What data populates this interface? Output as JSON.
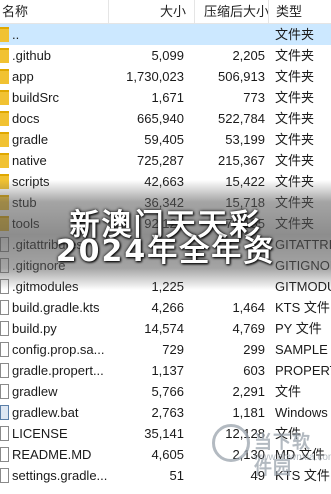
{
  "header": {
    "name": "名称",
    "size": "大小",
    "compressed": "压缩后大小",
    "type": "类型"
  },
  "rows": [
    {
      "name": "..",
      "size": "",
      "csize": "",
      "type": "文件夹",
      "icon": "folder",
      "selected": true
    },
    {
      "name": ".github",
      "size": "5,099",
      "csize": "2,205",
      "type": "文件夹",
      "icon": "folder"
    },
    {
      "name": "app",
      "size": "1,730,023",
      "csize": "506,913",
      "type": "文件夹",
      "icon": "folder"
    },
    {
      "name": "buildSrc",
      "size": "1,671",
      "csize": "773",
      "type": "文件夹",
      "icon": "folder"
    },
    {
      "name": "docs",
      "size": "665,940",
      "csize": "522,784",
      "type": "文件夹",
      "icon": "folder"
    },
    {
      "name": "gradle",
      "size": "59,405",
      "csize": "53,199",
      "type": "文件夹",
      "icon": "folder"
    },
    {
      "name": "native",
      "size": "725,287",
      "csize": "215,367",
      "type": "文件夹",
      "icon": "folder"
    },
    {
      "name": "scripts",
      "size": "42,663",
      "csize": "15,422",
      "type": "文件夹",
      "icon": "folder"
    },
    {
      "name": "stub",
      "size": "36,342",
      "csize": "15,718",
      "type": "文件夹",
      "icon": "folder"
    },
    {
      "name": "tools",
      "size": "92,129",
      "csize": "70,185",
      "type": "文件夹",
      "icon": "folder"
    },
    {
      "name": ".gitattributes",
      "size": "",
      "csize": "",
      "type": "GITATTRI",
      "icon": "file"
    },
    {
      "name": ".gitignore",
      "size": "",
      "csize": "",
      "type": "GITIGNOR",
      "icon": "file"
    },
    {
      "name": ".gitmodules",
      "size": "1,225",
      "csize": "",
      "type": "GITMODUL",
      "icon": "file"
    },
    {
      "name": "build.gradle.kts",
      "size": "4,266",
      "csize": "1,464",
      "type": "KTS 文件",
      "icon": "file"
    },
    {
      "name": "build.py",
      "size": "14,574",
      "csize": "4,769",
      "type": "PY 文件",
      "icon": "file"
    },
    {
      "name": "config.prop.sa...",
      "size": "729",
      "csize": "299",
      "type": "SAMPLE 文",
      "icon": "file"
    },
    {
      "name": "gradle.propert...",
      "size": "1,137",
      "csize": "603",
      "type": "PROPERT",
      "icon": "file"
    },
    {
      "name": "gradlew",
      "size": "5,766",
      "csize": "2,291",
      "type": "文件",
      "icon": "file"
    },
    {
      "name": "gradlew.bat",
      "size": "2,763",
      "csize": "1,181",
      "type": "Windows",
      "icon": "special"
    },
    {
      "name": "LICENSE",
      "size": "35,141",
      "csize": "12,128",
      "type": "文件",
      "icon": "file"
    },
    {
      "name": "README.MD",
      "size": "4,605",
      "csize": "2,130",
      "type": "MD 文件",
      "icon": "file"
    },
    {
      "name": "settings.gradle...",
      "size": "51",
      "csize": "49",
      "type": "KTS 文件",
      "icon": "file"
    }
  ],
  "overlay": {
    "line1": "新澳门天天彩",
    "line2": "2024年全年资"
  },
  "watermark": {
    "title": "当下软件园",
    "subtitle": "www.downxia.com"
  }
}
